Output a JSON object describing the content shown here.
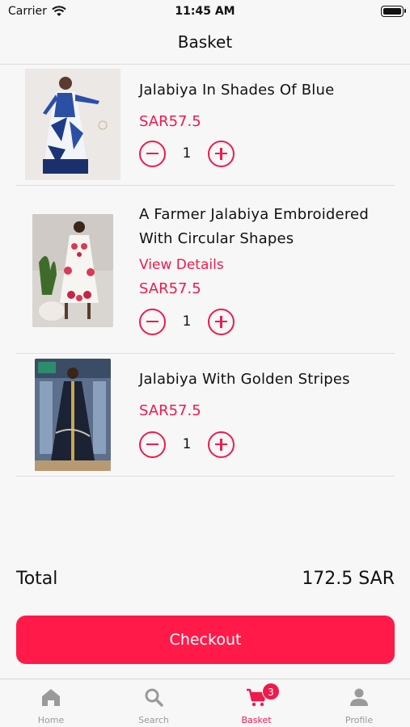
{
  "status": {
    "carrier": "Carrier",
    "time": "11:45 AM"
  },
  "nav": {
    "title": "Basket"
  },
  "items": [
    {
      "name": "Jalabiya In Shades Of Blue",
      "price": "SAR57.5",
      "quantity": "1"
    },
    {
      "name": "A Farmer Jalabiya Embroidered With Circular Shapes",
      "link": "View Details",
      "price": "SAR57.5",
      "quantity": "1"
    },
    {
      "name": "Jalabiya With Golden Stripes",
      "price": "SAR57.5",
      "quantity": "1"
    }
  ],
  "total": {
    "label": "Total",
    "value": "172.5 SAR"
  },
  "checkout": {
    "label": "Checkout"
  },
  "tabs": [
    {
      "label": "Home",
      "icon": "home-icon"
    },
    {
      "label": "Search",
      "icon": "search-icon"
    },
    {
      "label": "Basket",
      "icon": "cart-icon",
      "badge": "3",
      "active": true
    },
    {
      "label": "Profile",
      "icon": "profile-icon"
    }
  ],
  "colors": {
    "accent": "#ef1a4b",
    "checkout": "#ff1a4a",
    "inactive_tab": "#9a9a9a"
  }
}
